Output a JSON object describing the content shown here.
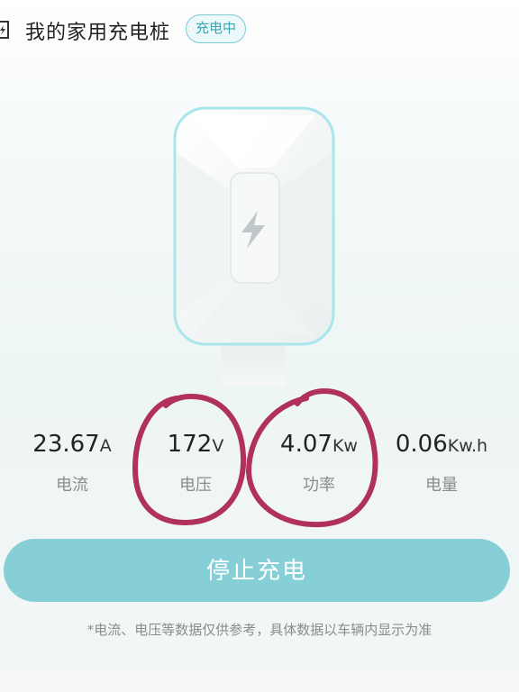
{
  "header": {
    "title": "我的家用充电桩",
    "status_badge": "充电中",
    "icon": "charger-icon"
  },
  "charger": {
    "icon": "lightning-icon"
  },
  "metrics": [
    {
      "value": "23.67",
      "unit": "A",
      "label": "电流"
    },
    {
      "value": "172",
      "unit": "V",
      "label": "电压"
    },
    {
      "value": "4.07",
      "unit": "Kw",
      "label": "功率"
    },
    {
      "value": "0.06",
      "unit": "Kw.h",
      "label": "电量"
    }
  ],
  "actions": {
    "stop_label": "停止充电"
  },
  "disclaimer": "*电流、电压等数据仅供参考，具体数据以车辆内显示为准",
  "colors": {
    "accent": "#86cfd7",
    "badge_text": "#3aa7b2",
    "annotation": "#b0305e"
  }
}
